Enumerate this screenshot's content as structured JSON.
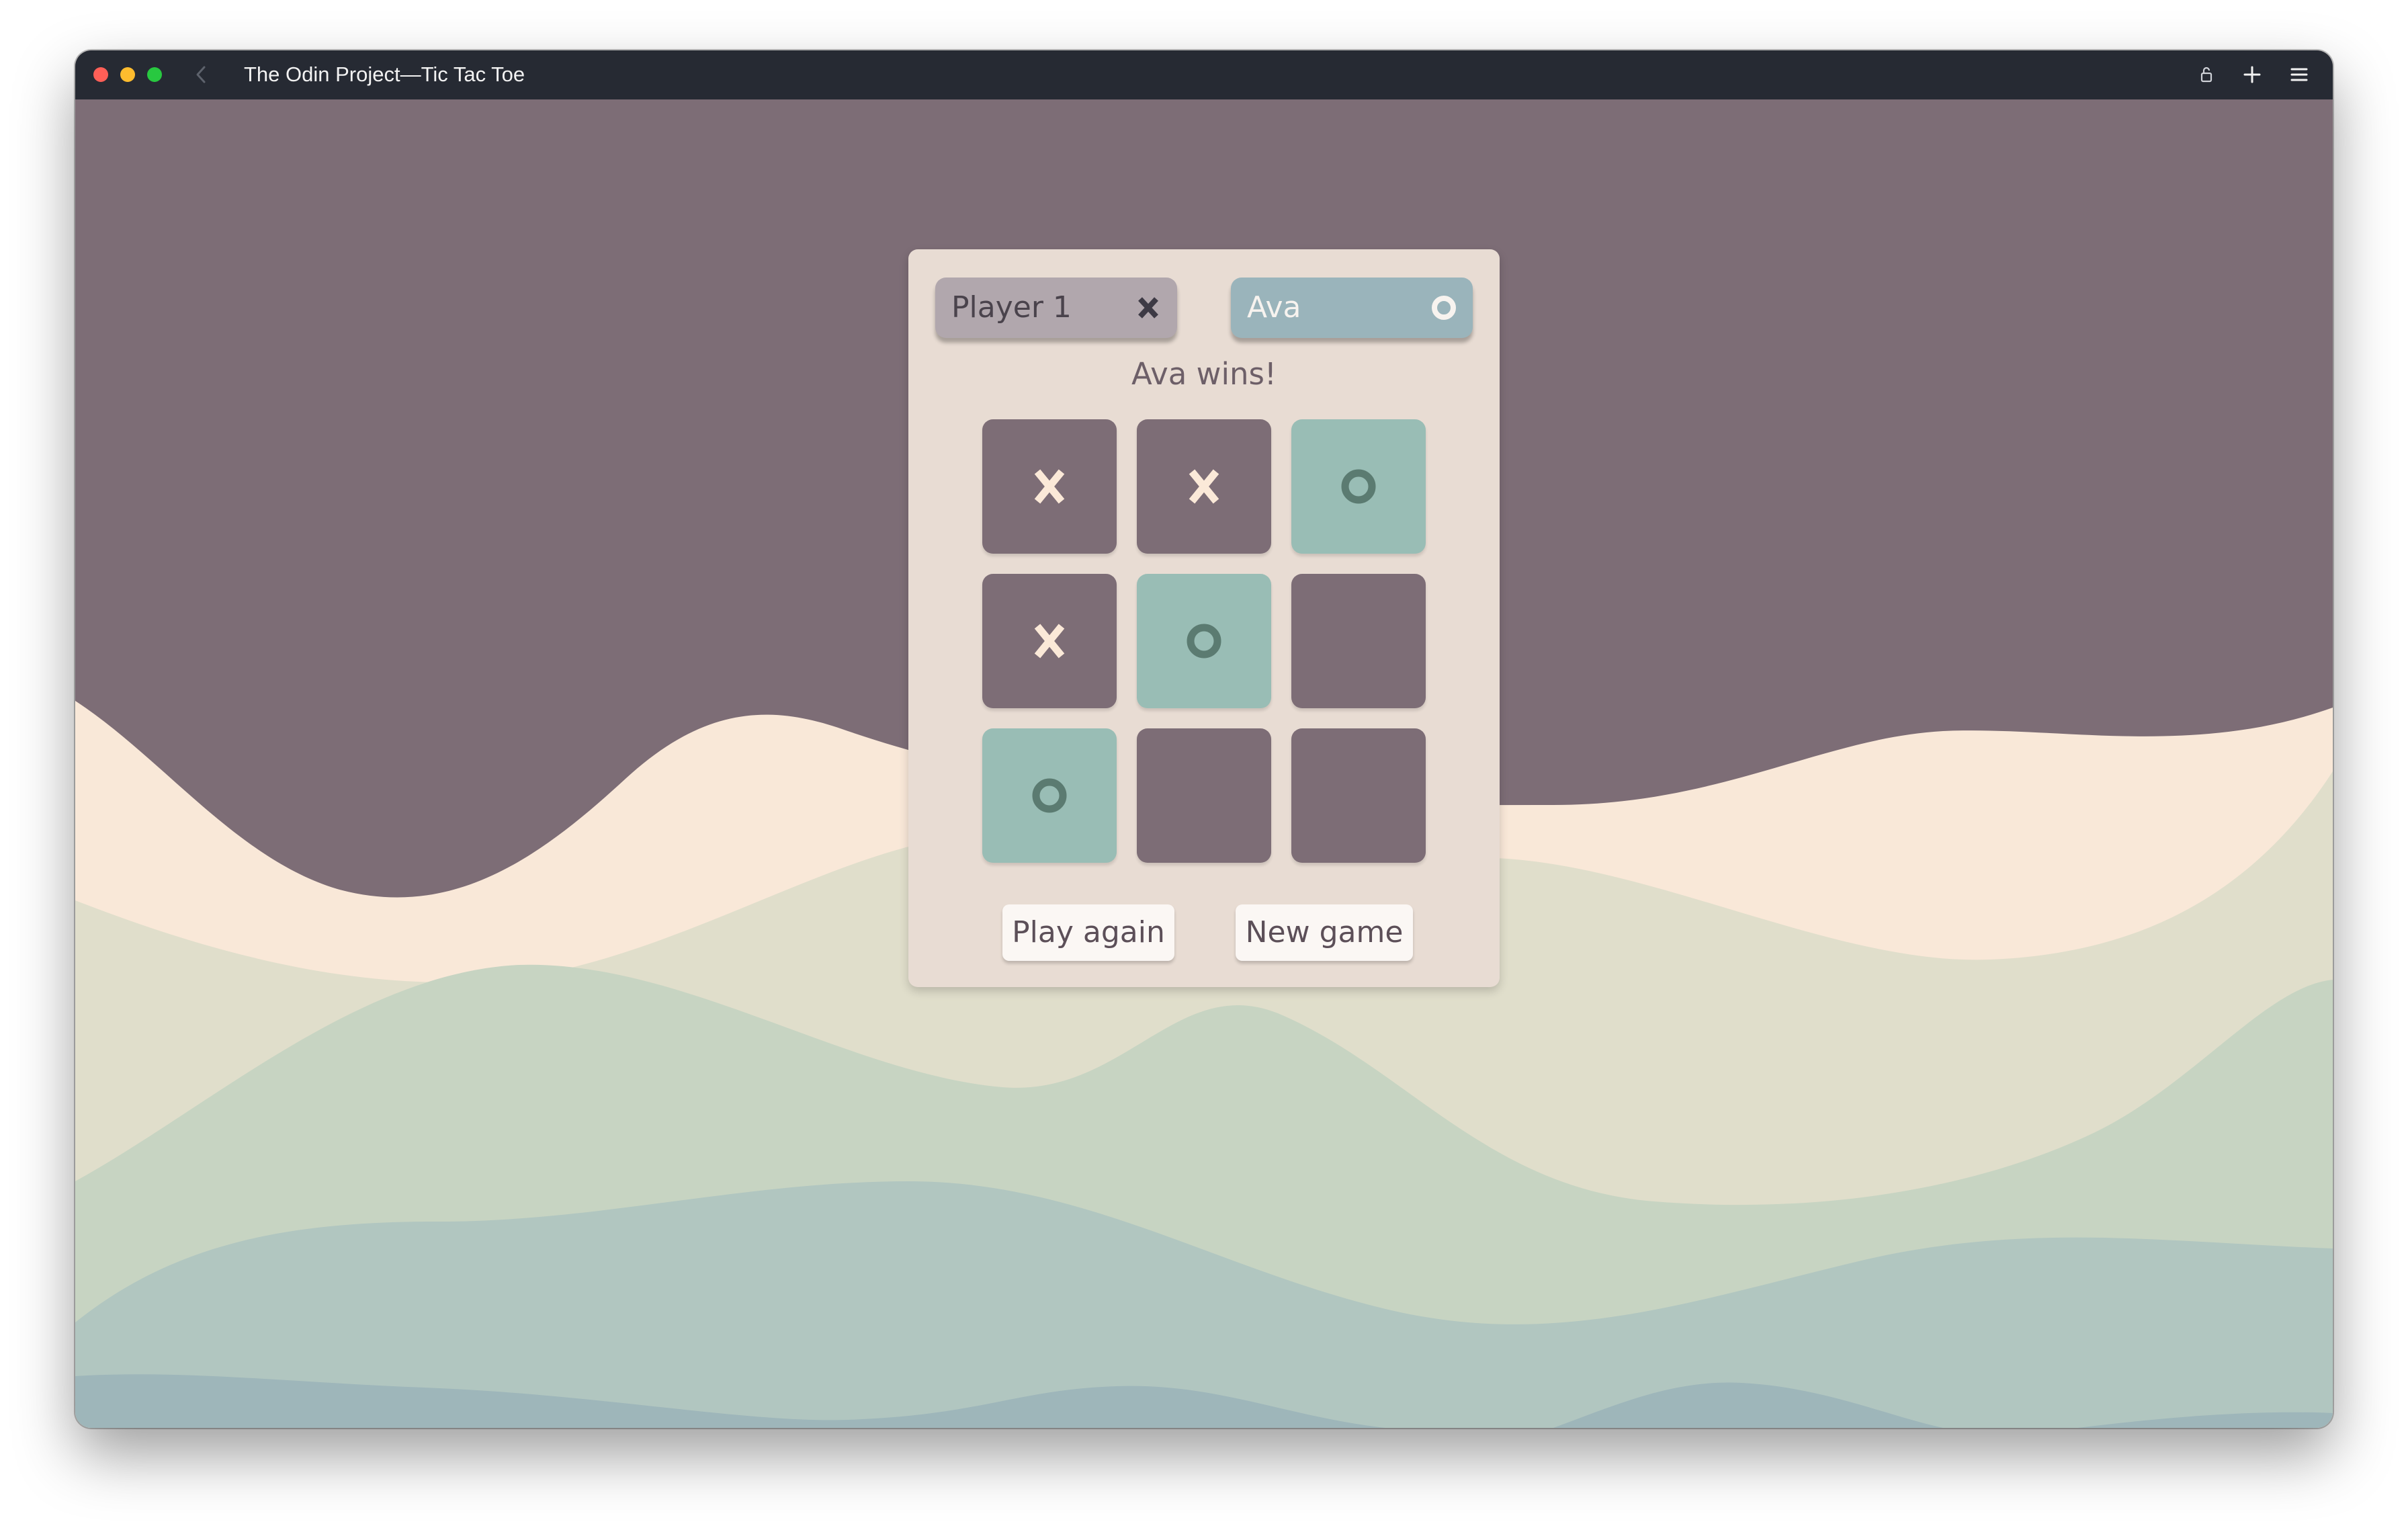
{
  "window": {
    "title": "The Odin Project—Tic Tac Toe"
  },
  "players": [
    {
      "name": "Player 1",
      "mark": "X",
      "active": false
    },
    {
      "name": "Ava",
      "mark": "O",
      "active": true
    }
  ],
  "status": "Ava wins!",
  "board": [
    [
      "X",
      "X",
      "O"
    ],
    [
      "X",
      "O",
      ""
    ],
    [
      "O",
      "",
      ""
    ]
  ],
  "buttons": {
    "play_again": "Play again",
    "new_game": "New game"
  },
  "colors": {
    "background": "#7d6d76",
    "card": "#e8dcd3",
    "x_cell": "#7d6d76",
    "o_cell": "#99bdb5",
    "x_mark": "#fbe9d8",
    "o_mark": "#5b7b71"
  },
  "icons": {
    "titlebar": [
      "back-icon",
      "lock-icon",
      "plus-icon",
      "menu-icon"
    ]
  }
}
